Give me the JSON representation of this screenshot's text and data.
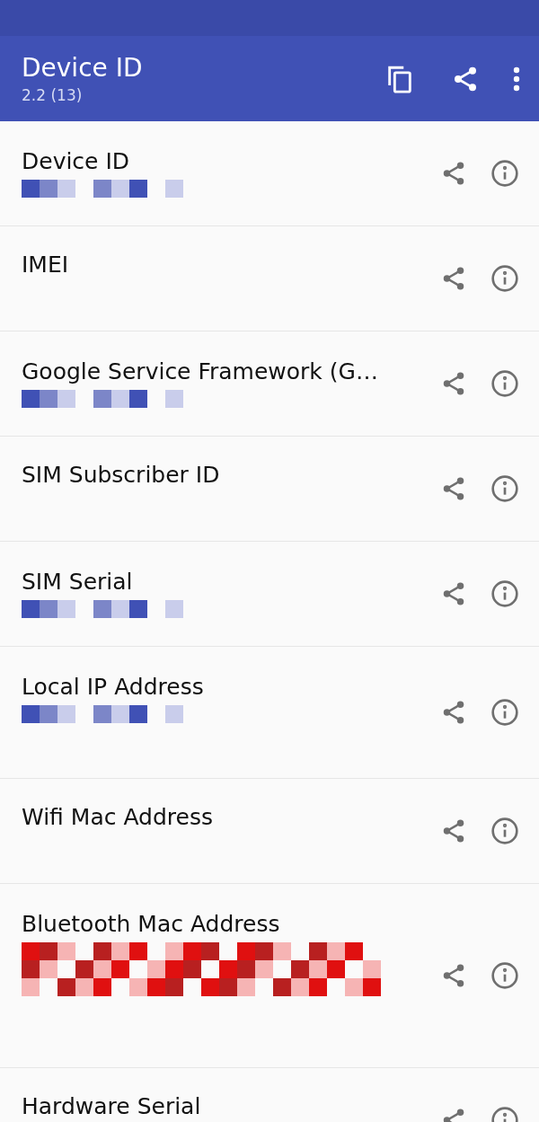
{
  "app_bar": {
    "title": "Device ID",
    "subtitle": "2.2 (13)"
  },
  "items": [
    {
      "title": "Device ID",
      "kind": "redacted-blue"
    },
    {
      "title": "IMEI",
      "kind": "empty"
    },
    {
      "title": "Google Service Framework (G…",
      "kind": "redacted-blue"
    },
    {
      "title": "SIM Subscriber ID",
      "kind": "empty"
    },
    {
      "title": "SIM Serial",
      "kind": "redacted-blue"
    },
    {
      "title": "Local IP Address",
      "kind": "redacted-blue-tall"
    },
    {
      "title": "Wifi Mac Address",
      "kind": "empty"
    },
    {
      "title": "Bluetooth Mac Address",
      "kind": "redacted-red"
    },
    {
      "title": "Hardware Serial",
      "kind": "empty"
    }
  ]
}
